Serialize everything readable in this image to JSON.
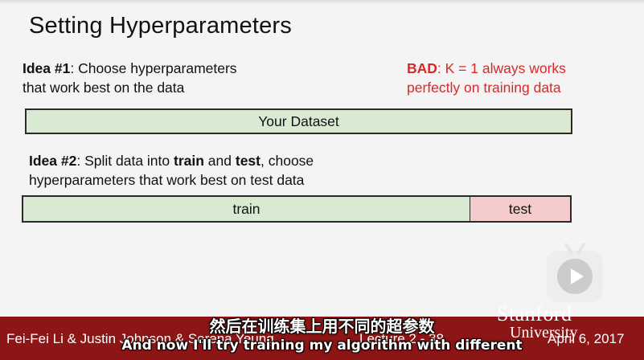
{
  "slide": {
    "title": "Setting Hyperparameters",
    "idea1": {
      "label": "Idea #1",
      "text_line1": ": Choose hyperparameters",
      "text_line2": "that work best on the data"
    },
    "bad_note": {
      "label": "BAD",
      "text_line1": ": K = 1 always works",
      "text_line2": "perfectly on training data",
      "color": "#d42a2a"
    },
    "dataset_bar": {
      "label": "Your Dataset",
      "color": "#d9ead3"
    },
    "idea2": {
      "label": "Idea #2",
      "part1": ": Split data into ",
      "train_word": "train",
      "part2": " and ",
      "test_word": "test",
      "part3": ", choose",
      "line2": "hyperparameters that work best on test data"
    },
    "split_bar": {
      "train_label": "train",
      "test_label": "test",
      "train_color": "#d9ead3",
      "test_color": "#f4cccc"
    }
  },
  "footer": {
    "authors": "Fei-Fei Li & Justin Johnson & Serena Yeung",
    "lecture": "Lecture 2 - 38",
    "date": "April 6, 2017",
    "logo_line1": "Stanford",
    "logo_line2": "University",
    "color": "#8c1515"
  },
  "subtitles": {
    "chinese": "然后在训练集上用不同的超参数",
    "english": "And now I'll try training my algorithm with different"
  },
  "player": {
    "icon": "play-icon"
  }
}
